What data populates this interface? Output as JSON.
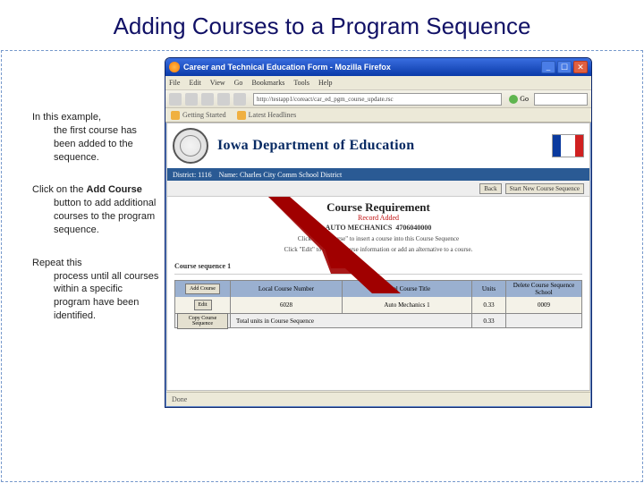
{
  "slide": {
    "title": "Adding Courses to a Program Sequence"
  },
  "left": {
    "p1_first": "In this example,",
    "p1_rest": "the first course has been added to the sequence.",
    "p2_first": "Click on the ",
    "p2_bold": "Add Course",
    "p2_rest": " button to add additional courses to the program sequence.",
    "p3_first": "Repeat this",
    "p3_rest": "process until all courses within a specific program have been identified."
  },
  "window": {
    "title": "Career and Technical Education Form - Mozilla Firefox",
    "menu": [
      "File",
      "Edit",
      "View",
      "Go",
      "Bookmarks",
      "Tools",
      "Help"
    ],
    "url": "http://testapp1/coreact/car_ed_pgm_course_update.rsc",
    "go": "Go",
    "bookmarks": [
      "Getting Started",
      "Latest Headlines"
    ],
    "status": "Done"
  },
  "page": {
    "dept": "Iowa Department of Education",
    "district_label": "District: 1116",
    "district_name_label": "Name: Charles City Comm School District",
    "back_btn": "Back",
    "startnew_btn": "Start New Course Sequence",
    "section_title": "Course Requirement",
    "record_added": "Record Added",
    "auto_label": "AUTO MECHANICS",
    "auto_code": "4706040000",
    "instr1": "Click \"Add Course\" to insert a course into this Course Sequence",
    "instr2": "Click \"Edit\" to change course information or add an alternative to a course.",
    "seq_label": "Course sequence 1",
    "grid": {
      "btn_add": "Add Course",
      "h2": "Local Course Number",
      "h3": "Local Course Title",
      "h4": "Units",
      "h5": "Delete Course Sequence School",
      "btn_edit": "Edit",
      "r_num": "6028",
      "r_title": "Auto Mechanics 1",
      "r_units": "0.33",
      "r_sch": "0009",
      "btn_copy": "Copy Course Sequence",
      "total_label": "Total units in Course Sequence",
      "total_val": "0.33"
    }
  }
}
